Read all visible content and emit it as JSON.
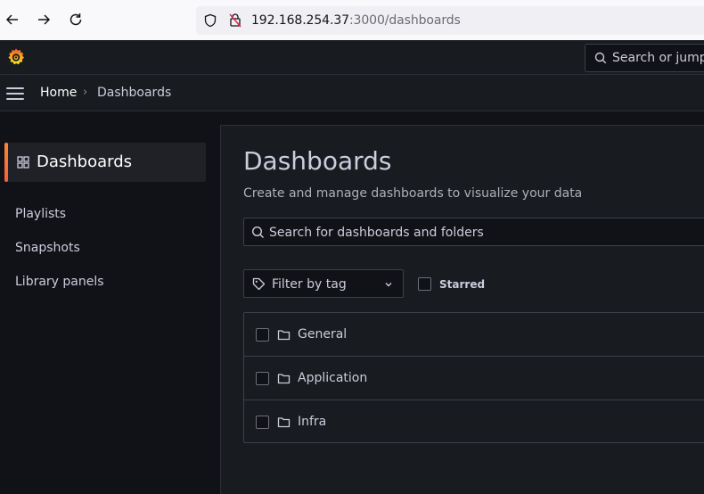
{
  "browser": {
    "url_host": "192.168.254.37",
    "url_rest": ":3000/dashboards"
  },
  "topbar": {
    "search_label": "Search or jump"
  },
  "breadcrumb": {
    "home": "Home",
    "separator": "›",
    "current": "Dashboards"
  },
  "section_nav": {
    "active_label": "Dashboards",
    "items": [
      {
        "label": "Playlists"
      },
      {
        "label": "Snapshots"
      },
      {
        "label": "Library panels"
      }
    ]
  },
  "main": {
    "title": "Dashboards",
    "subtitle": "Create and manage dashboards to visualize your data",
    "search_placeholder": "Search for dashboards and folders",
    "tag_filter_label": "Filter by tag",
    "starred_label": "Starred",
    "folders": [
      {
        "name": "General"
      },
      {
        "name": "Application"
      },
      {
        "name": "Infra"
      }
    ]
  },
  "colors": {
    "accent": "#f55f3e",
    "background": "#111217",
    "panel": "#181b1f"
  }
}
